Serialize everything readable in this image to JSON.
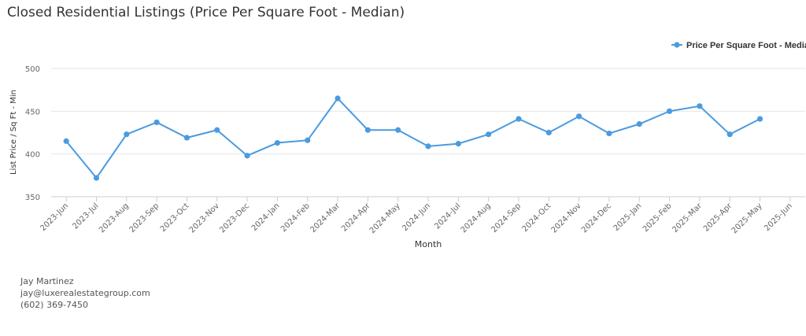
{
  "title": "Closed Residential Listings (Price Per Square Foot - Median)",
  "contact": {
    "name": "Jay Martinez",
    "email": "jay@luxerealestategroup.com",
    "phone": "(602) 369-7450"
  },
  "colors": {
    "series": "#4a9be0",
    "grid": "#e6e6e6",
    "axis_text": "#666666"
  },
  "chart_data": {
    "type": "line",
    "xlabel": "Month",
    "ylabel": "List Price / Sq Ft - Min",
    "ylim": [
      350,
      500
    ],
    "yticks": [
      350,
      400,
      450,
      500
    ],
    "grid": true,
    "legend_position": "top-right",
    "categories": [
      "2023-Jun",
      "2023-Jul",
      "2023-Aug",
      "2023-Sep",
      "2023-Oct",
      "2023-Nov",
      "2023-Dec",
      "2024-Jan",
      "2024-Feb",
      "2024-Mar",
      "2024-Apr",
      "2024-May",
      "2024-Jun",
      "2024-Jul",
      "2024-Aug",
      "2024-Sep",
      "2024-Oct",
      "2024-Nov",
      "2024-Dec",
      "2025-Jan",
      "2025-Feb",
      "2025-Mar",
      "2025-Apr",
      "2025-May",
      "2025-Jun"
    ],
    "series": [
      {
        "name": "Price Per Square Foot - Median",
        "values": [
          415,
          372,
          423,
          437,
          419,
          428,
          398,
          413,
          416,
          465,
          428,
          428,
          409,
          412,
          423,
          441,
          425,
          444,
          424,
          435,
          450,
          456,
          423,
          441,
          null
        ]
      }
    ]
  }
}
